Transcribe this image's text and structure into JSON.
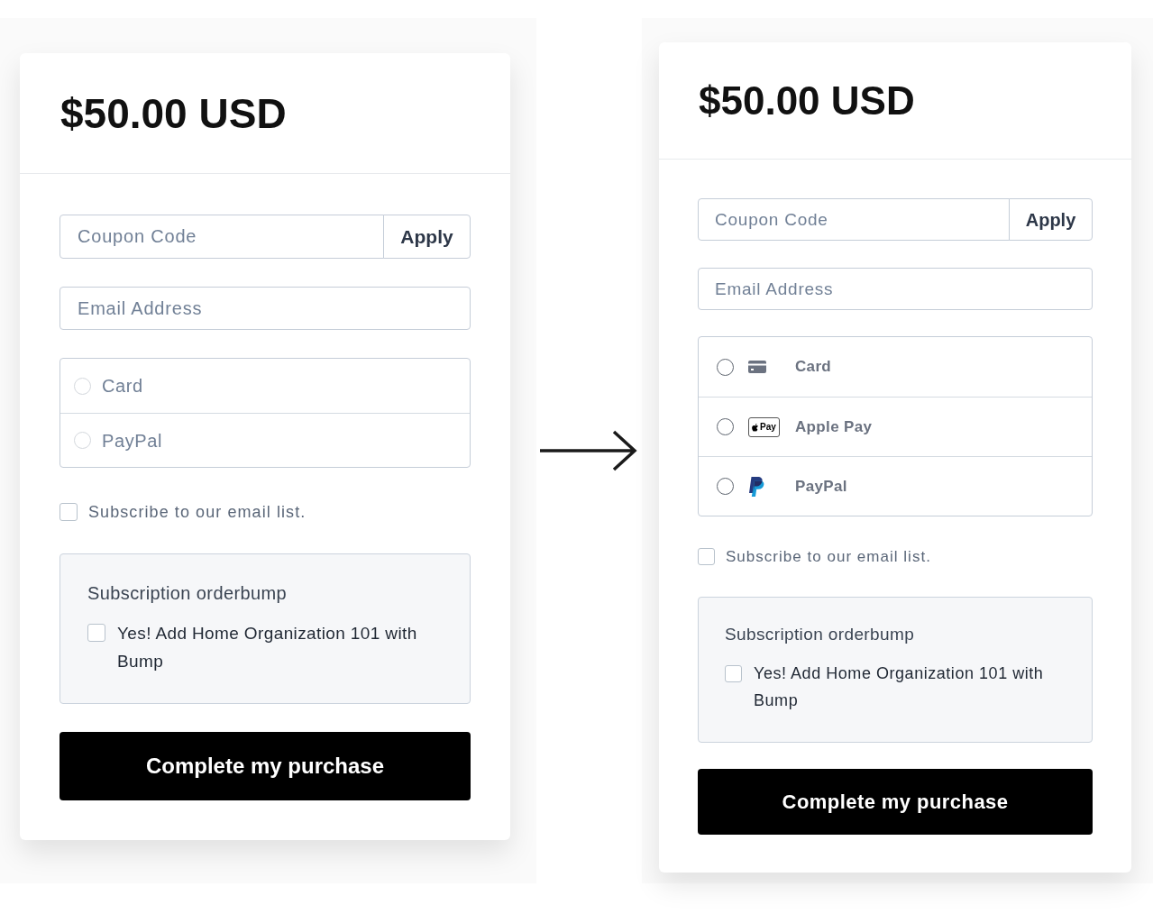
{
  "panels": [
    {
      "kind": "classic",
      "price": "$50.00 USD",
      "coupon": {
        "placeholder": "Coupon Code",
        "button": "Apply"
      },
      "email": {
        "placeholder": "Email Address"
      },
      "payment_methods": [
        {
          "label": "Card",
          "selected": false
        },
        {
          "label": "PayPal",
          "selected": false
        }
      ],
      "subscribe": {
        "label": "Subscribe to our email list.",
        "checked": false
      },
      "order_bump": {
        "title": "Subscription orderbump",
        "label": "Yes! Add Home Organization 101 with Bump",
        "checked": false
      },
      "submit": "Complete my purchase"
    },
    {
      "kind": "updated",
      "price": "$50.00 USD",
      "coupon": {
        "placeholder": "Coupon Code",
        "button": "Apply"
      },
      "email": {
        "placeholder": "Email Address"
      },
      "payment_methods": [
        {
          "kind": "card",
          "label": "Card",
          "selected": false
        },
        {
          "kind": "applepay",
          "badge": "Pay",
          "label": "Apple Pay",
          "selected": false
        },
        {
          "kind": "paypal",
          "label": "PayPal",
          "selected": false
        }
      ],
      "subscribe": {
        "label": "Subscribe to our email list.",
        "checked": false
      },
      "order_bump": {
        "title": "Subscription orderbump",
        "label": "Yes! Add Home Organization 101 with Bump",
        "checked": false
      },
      "submit": "Complete my purchase"
    }
  ]
}
